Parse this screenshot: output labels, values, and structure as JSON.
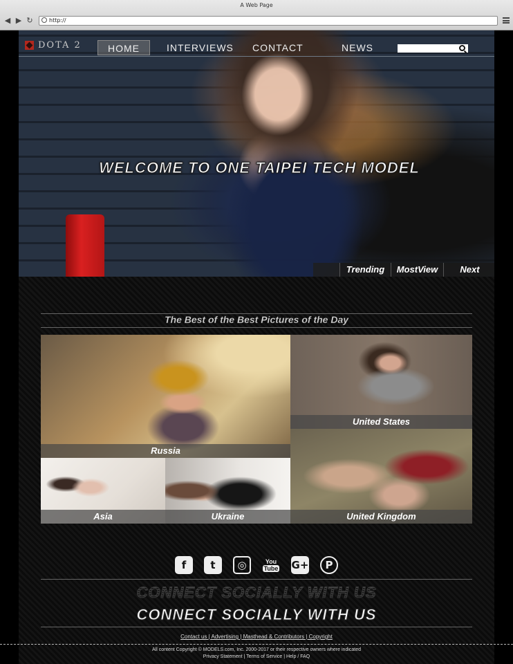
{
  "browser": {
    "title": "A Web Page",
    "url": "http://"
  },
  "header": {
    "logo_text": "DOTA 2",
    "nav": [
      "HOME",
      "INTERVIEWS",
      "CONTACT",
      "NEWS"
    ],
    "active_nav": "HOME",
    "search_placeholder": ""
  },
  "hero": {
    "title": "WELCOME TO ONE TAIPEI TECH MODEL",
    "tabs": [
      "Trending",
      "MostView",
      "Next"
    ]
  },
  "gallery": {
    "title": "The Best of the Best Pictures of the Day",
    "tiles": {
      "russia": "Russia",
      "us": "United States",
      "asia": "Asia",
      "ukraine": "Ukraine",
      "uk": "United Kingdom"
    }
  },
  "social": {
    "icons": [
      "facebook-icon",
      "twitter-icon",
      "instagram-icon",
      "youtube-icon",
      "google-plus-icon",
      "pinterest-icon"
    ],
    "youtube_top": "You",
    "youtube_bottom": "Tube",
    "google_plus": "G+",
    "connect_ghost": "CONNECT SOCIALLY WITH US",
    "connect": "CONNECT SOCIALLY WITH US"
  },
  "footer": {
    "links": "Contact us | Advertising | Masthead & Contributors | Copyright",
    "copyright": "All content Copyright © MODELS.com, Inc. 2000-2017 or their respective owners where indicated",
    "legal": "Privacy Statement | Terms of Service | Help / FAQ"
  }
}
